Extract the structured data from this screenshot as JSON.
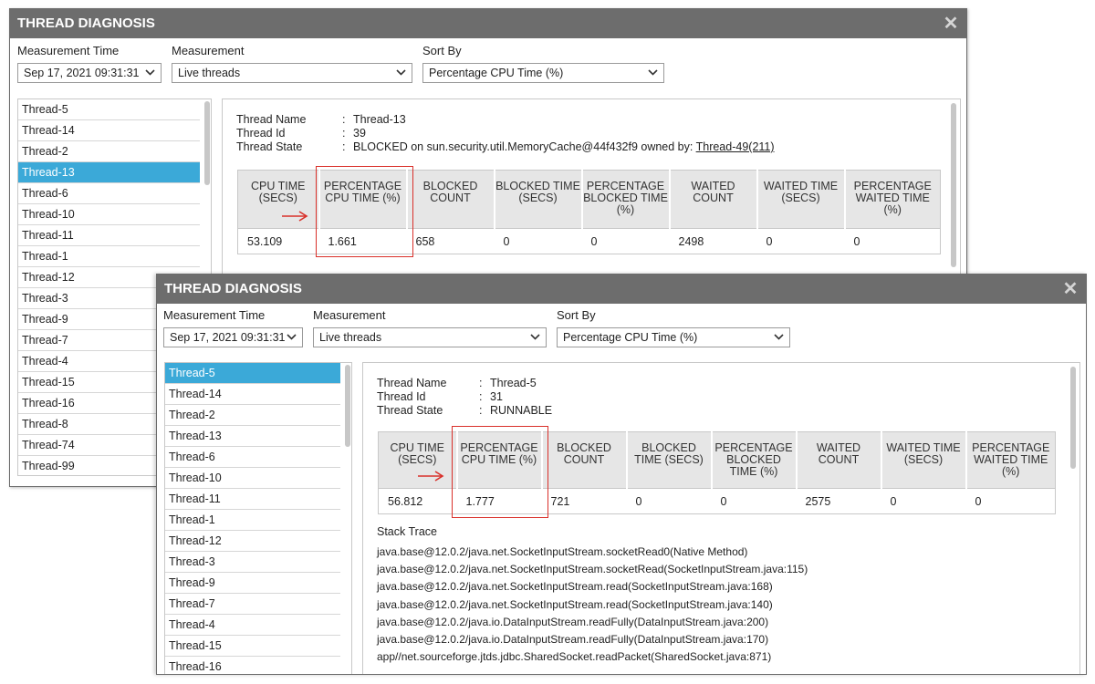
{
  "dialog_back": {
    "title": "THREAD DIAGNOSIS",
    "close_label": "✕",
    "labels": {
      "time": "Measurement Time",
      "measurement": "Measurement",
      "sort": "Sort By"
    },
    "selects": {
      "time": "Sep 17, 2021 09:31:31",
      "measurement": "Live threads",
      "sort": "Percentage CPU Time (%)"
    },
    "threads": [
      "Thread-5",
      "Thread-14",
      "Thread-2",
      "Thread-13",
      "Thread-6",
      "Thread-10",
      "Thread-11",
      "Thread-1",
      "Thread-12",
      "Thread-3",
      "Thread-9",
      "Thread-7",
      "Thread-4",
      "Thread-15",
      "Thread-16",
      "Thread-8",
      "Thread-74",
      "Thread-99"
    ],
    "selected_thread": "Thread-13",
    "info": {
      "name_key": "Thread Name",
      "name": "Thread-13",
      "id_key": "Thread Id",
      "id": "39",
      "state_key": "Thread State",
      "state": "BLOCKED on sun.security.util.MemoryCache@44f432f9 owned by: ",
      "state_link": "Thread-49(211)"
    },
    "headers": [
      "CPU TIME (SECS)",
      "PERCENTAGE CPU TIME (%)",
      "BLOCKED COUNT",
      "BLOCKED TIME (SECS)",
      "PERCENTAGE BLOCKED TIME (%)",
      "WAITED COUNT",
      "WAITED TIME (SECS)",
      "PERCENTAGE WAITED TIME (%)"
    ],
    "values": [
      "53.109",
      "1.661",
      "658",
      "0",
      "0",
      "2498",
      "0",
      "0"
    ]
  },
  "dialog_front": {
    "title": "THREAD DIAGNOSIS",
    "close_label": "✕",
    "labels": {
      "time": "Measurement Time",
      "measurement": "Measurement",
      "sort": "Sort By"
    },
    "selects": {
      "time": "Sep 17, 2021 09:31:31",
      "measurement": "Live threads",
      "sort": "Percentage CPU Time (%)"
    },
    "threads": [
      "Thread-5",
      "Thread-14",
      "Thread-2",
      "Thread-13",
      "Thread-6",
      "Thread-10",
      "Thread-11",
      "Thread-1",
      "Thread-12",
      "Thread-3",
      "Thread-9",
      "Thread-7",
      "Thread-4",
      "Thread-15",
      "Thread-16"
    ],
    "selected_thread": "Thread-5",
    "info": {
      "name_key": "Thread Name",
      "name": "Thread-5",
      "id_key": "Thread Id",
      "id": "31",
      "state_key": "Thread State",
      "state": "RUNNABLE"
    },
    "headers": [
      "CPU TIME (SECS)",
      "PERCENTAGE CPU TIME (%)",
      "BLOCKED COUNT",
      "BLOCKED TIME (SECS)",
      "PERCENTAGE BLOCKED TIME (%)",
      "WAITED COUNT",
      "WAITED TIME (SECS)",
      "PERCENTAGE WAITED TIME (%)"
    ],
    "values": [
      "56.812",
      "1.777",
      "721",
      "0",
      "0",
      "2575",
      "0",
      "0"
    ],
    "stack_title": "Stack Trace",
    "stack": [
      "java.base@12.0.2/java.net.SocketInputStream.socketRead0(Native Method)",
      "java.base@12.0.2/java.net.SocketInputStream.socketRead(SocketInputStream.java:115)",
      "java.base@12.0.2/java.net.SocketInputStream.read(SocketInputStream.java:168)",
      "java.base@12.0.2/java.net.SocketInputStream.read(SocketInputStream.java:140)",
      "java.base@12.0.2/java.io.DataInputStream.readFully(DataInputStream.java:200)",
      "java.base@12.0.2/java.io.DataInputStream.readFully(DataInputStream.java:170)",
      "app//net.sourceforge.jtds.jdbc.SharedSocket.readPacket(SharedSocket.java:871)"
    ]
  },
  "annotation": {
    "highlight_color": "#d9302a",
    "arrow_icon": "right-arrow-icon"
  },
  "colors": {
    "titlebar": "#6d6d6d",
    "selected": "#3ba9d8",
    "header_bg": "#e6e6e6"
  }
}
